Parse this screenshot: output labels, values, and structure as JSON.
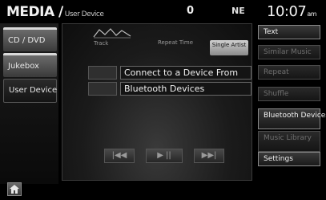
{
  "header": {
    "title": "MEDIA /",
    "subtitle": "User Device",
    "signal_icon": "0",
    "phone_icon": "NE",
    "clock": "10:07",
    "ampm": "am"
  },
  "sidebar": {
    "items": [
      {
        "label": "CD / DVD"
      },
      {
        "label": "Jukebox"
      },
      {
        "label": "User Device"
      }
    ]
  },
  "main": {
    "track_label": "Track",
    "repeat_label": "Repeat Time",
    "repeat_button": "Single Artist",
    "message_line1": "Connect to a Device From",
    "message_line2": "Bluetooth Devices",
    "transport": {
      "prev": "|◀◀",
      "play_pause": "▶ ||",
      "next": "▶▶|"
    }
  },
  "right_menu": {
    "items": [
      {
        "label": "Text",
        "enabled": true
      },
      {
        "label": "Similar Music",
        "enabled": false
      },
      {
        "label": "Repeat",
        "enabled": false
      },
      {
        "label": "Shuffle",
        "enabled": false
      },
      {
        "label": "Bluetooth Devices",
        "enabled": true
      },
      {
        "label": "Music Library",
        "enabled": false
      },
      {
        "label": "Settings",
        "enabled": true
      }
    ]
  },
  "footer": {
    "home_icon": "home-icon"
  }
}
